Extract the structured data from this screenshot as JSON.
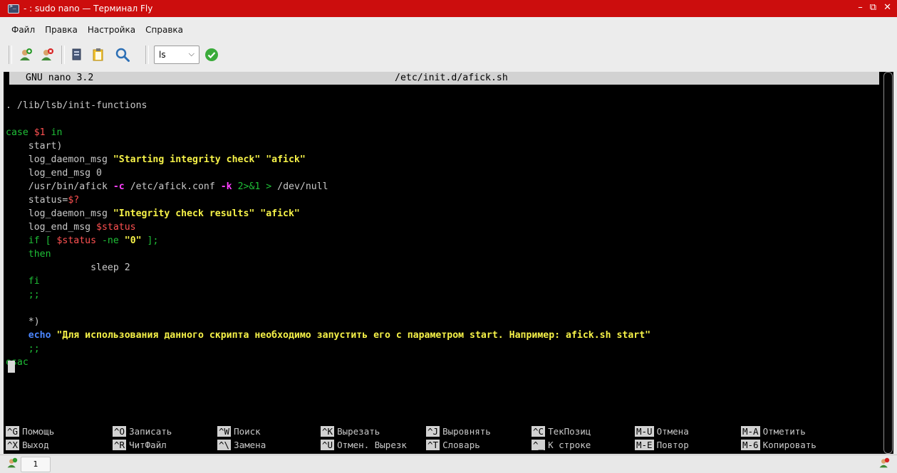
{
  "window": {
    "title": "- : sudo nano — Терминал Fly",
    "controls": [
      "–",
      "⧉",
      "✕"
    ]
  },
  "menu": [
    "Файл",
    "Правка",
    "Настройка",
    "Справка"
  ],
  "toolbar": {
    "combo_value": "ls"
  },
  "nano": {
    "version": "GNU nano 3.2",
    "filename": "/etc/init.d/afick.sh",
    "lines": {
      "l1": ". /lib/lsb/init-functions",
      "l2a": "case ",
      "l2b": "$1",
      "l2c": " in",
      "l3": "    start)",
      "l4a": "    log_daemon_msg ",
      "l4b": "\"Starting integrity check\" \"afick\"",
      "l5": "    log_end_msg 0",
      "l6a": "    /usr/bin/afick ",
      "l6b": "-c",
      "l6c": " /etc/afick.conf ",
      "l6d": "-k",
      "l6e": " 2>&1 > ",
      "l6f": "/dev/null",
      "l7a": "    status=",
      "l7b": "$?",
      "l8a": "    log_daemon_msg ",
      "l8b": "\"Integrity check results\" \"afick\"",
      "l9a": "    log_end_msg ",
      "l9b": "$status",
      "l10a": "    if [ ",
      "l10b": "$status",
      "l10c": " -ne ",
      "l10d": "\"0\"",
      "l10e": " ];",
      "l11": "    then",
      "l12": "               sleep 2",
      "l13": "    fi",
      "l14": "    ;;",
      "l15": "    *)",
      "l16a": "    echo ",
      "l16b": "\"Для использования данного скрипта необходимо запустить его с параметром start. Например: afick.sh start\"",
      "l17": "    ;;",
      "l18": "esac"
    },
    "shortcuts": [
      {
        "key": "^G",
        "label": "Помощь"
      },
      {
        "key": "^X",
        "label": "Выход"
      },
      {
        "key": "^O",
        "label": "Записать"
      },
      {
        "key": "^R",
        "label": "ЧитФайл"
      },
      {
        "key": "^W",
        "label": "Поиск"
      },
      {
        "key": "^\\",
        "label": "Замена"
      },
      {
        "key": "^K",
        "label": "Вырезать"
      },
      {
        "key": "^U",
        "label": "Отмен. Вырезк"
      },
      {
        "key": "^J",
        "label": "Выровнять"
      },
      {
        "key": "^T",
        "label": "Словарь"
      },
      {
        "key": "^C",
        "label": "ТекПозиц"
      },
      {
        "key": "^_",
        "label": "К строке"
      },
      {
        "key": "M-U",
        "label": "Отмена"
      },
      {
        "key": "M-E",
        "label": "Повтор"
      },
      {
        "key": "M-A",
        "label": "Отметить"
      },
      {
        "key": "M-6",
        "label": "Копировать"
      }
    ]
  },
  "statusbar": {
    "tab_label": "1"
  },
  "colors": {
    "titlebar": "#cc0d0d",
    "keyword": "#1fbf37",
    "string": "#f6f248",
    "variable": "#ff5151",
    "option": "#ff40ff"
  }
}
